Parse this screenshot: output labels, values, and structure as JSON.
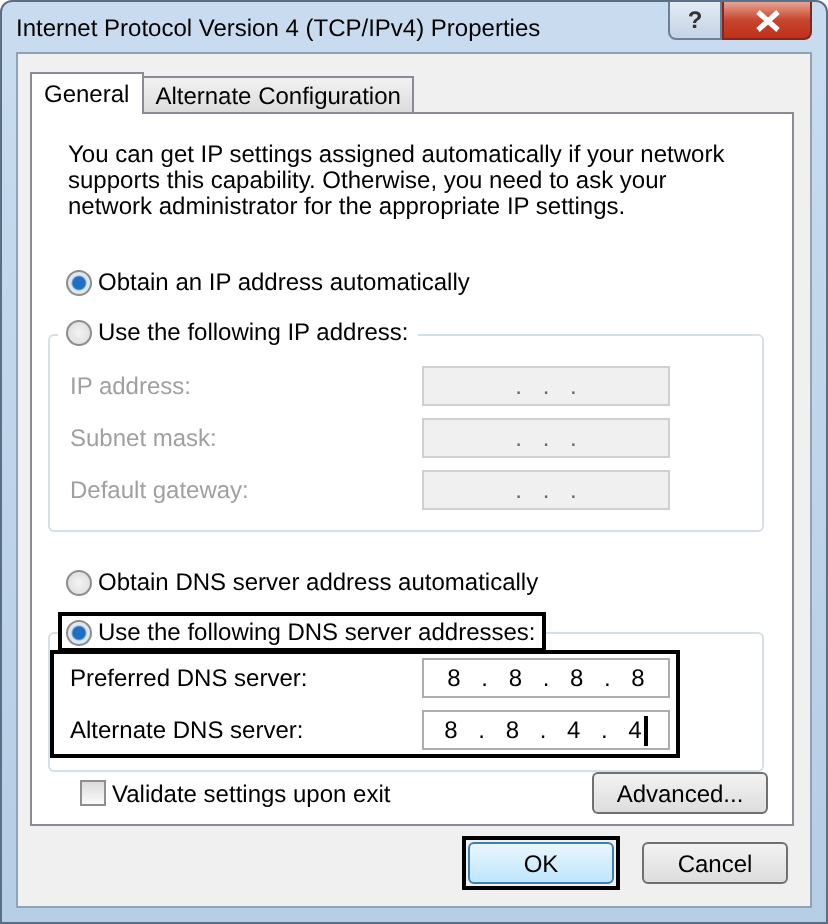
{
  "window": {
    "title": "Internet Protocol Version 4 (TCP/IPv4) Properties",
    "help": "?"
  },
  "tabs": [
    {
      "label": "General",
      "selected": true
    },
    {
      "label": "Alternate Configuration",
      "selected": false
    }
  ],
  "intro": "You can get IP settings assigned automatically if your network supports this capability. Otherwise, you need to ask your network administrator for the appropriate IP settings.",
  "ip_mode": [
    {
      "label": "Obtain an IP address automatically",
      "selected": true,
      "highlighted": false
    },
    {
      "label": "Use the following IP address:",
      "selected": false,
      "highlighted": false
    }
  ],
  "ip_fields": {
    "disabled": true,
    "highlighted": false,
    "rows": [
      {
        "label": "IP address:",
        "value": ". . .",
        "focused": false
      },
      {
        "label": "Subnet mask:",
        "value": ". . .",
        "focused": false
      },
      {
        "label": "Default gateway:",
        "value": ". . .",
        "focused": false
      }
    ]
  },
  "dns_mode": [
    {
      "label": "Obtain DNS server address automatically",
      "selected": false,
      "highlighted": false
    },
    {
      "label": "Use the following DNS server addresses:",
      "selected": true,
      "highlighted": true
    }
  ],
  "dns_fields": {
    "disabled": false,
    "highlighted": true,
    "rows": [
      {
        "label": "Preferred DNS server:",
        "value": "8 . 8 . 8 . 8",
        "focused": false
      },
      {
        "label": "Alternate DNS server:",
        "value": "8 . 8 . 4 . 4",
        "focused": true
      }
    ]
  },
  "validate": {
    "label": "Validate settings upon exit",
    "checked": false
  },
  "advanced_button": "Advanced...",
  "buttons": [
    {
      "label": "OK",
      "default": true,
      "highlighted": true
    },
    {
      "label": "Cancel",
      "default": false,
      "highlighted": false
    }
  ]
}
